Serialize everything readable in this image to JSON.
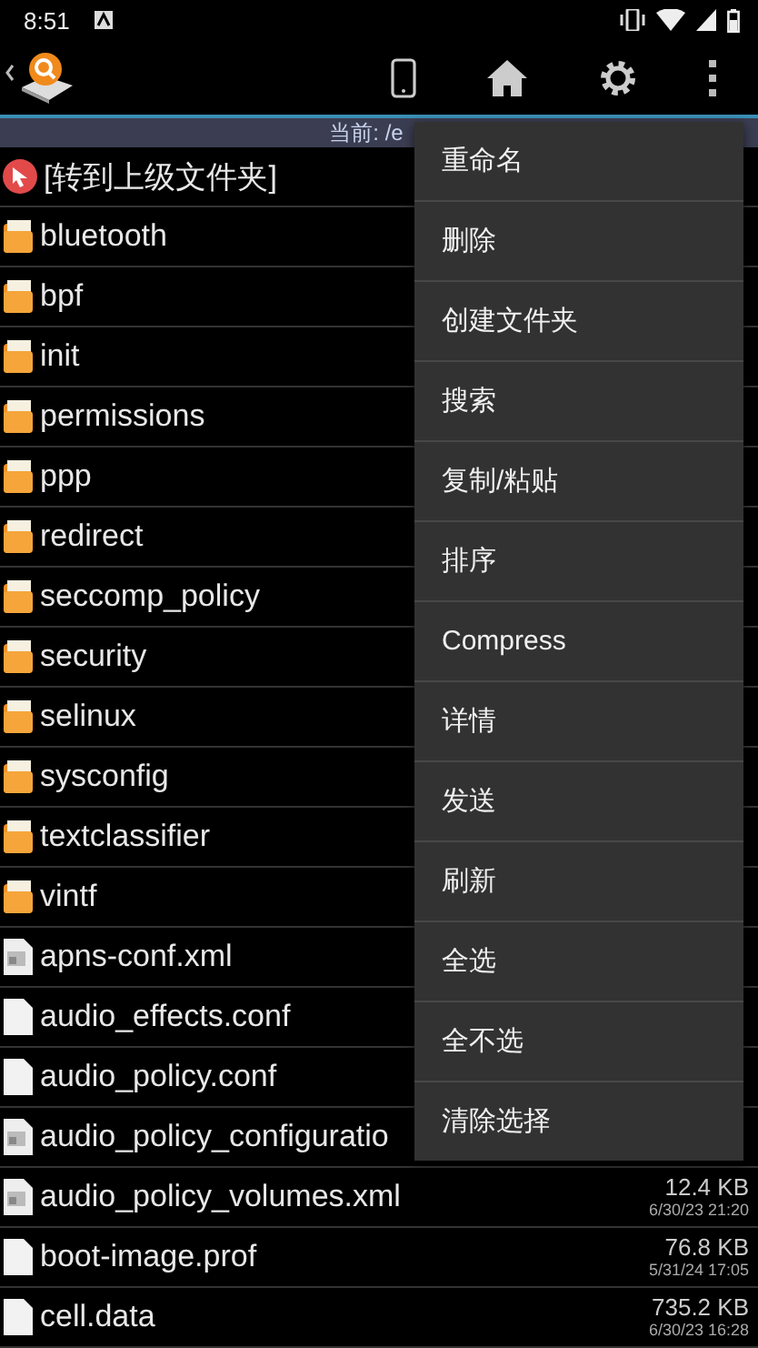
{
  "status_bar": {
    "time": "8:51"
  },
  "path_bar": {
    "text": "当前: /e"
  },
  "files": [
    {
      "kind": "up",
      "name": "[转到上级文件夹]"
    },
    {
      "kind": "folder",
      "name": "bluetooth"
    },
    {
      "kind": "folder",
      "name": "bpf"
    },
    {
      "kind": "folder",
      "name": "init"
    },
    {
      "kind": "folder",
      "name": "permissions"
    },
    {
      "kind": "folder",
      "name": "ppp"
    },
    {
      "kind": "folder",
      "name": "redirect"
    },
    {
      "kind": "folder",
      "name": "seccomp_policy"
    },
    {
      "kind": "folder",
      "name": "security"
    },
    {
      "kind": "folder",
      "name": "selinux"
    },
    {
      "kind": "folder",
      "name": "sysconfig"
    },
    {
      "kind": "folder",
      "name": "textclassifier"
    },
    {
      "kind": "folder",
      "name": "vintf"
    },
    {
      "kind": "xml",
      "name": "apns-conf.xml"
    },
    {
      "kind": "file",
      "name": "audio_effects.conf"
    },
    {
      "kind": "file",
      "name": "audio_policy.conf"
    },
    {
      "kind": "xml",
      "name": "audio_policy_configuratio"
    },
    {
      "kind": "xml",
      "name": "audio_policy_volumes.xml",
      "size": "12.4 KB",
      "date": "6/30/23 21:20"
    },
    {
      "kind": "file",
      "name": "boot-image.prof",
      "size": "76.8 KB",
      "date": "5/31/24 17:05"
    },
    {
      "kind": "file",
      "name": "cell.data",
      "size": "735.2 KB",
      "date": "6/30/23 16:28"
    }
  ],
  "menu": [
    "重命名",
    "删除",
    "创建文件夹",
    "搜索",
    "复制/粘贴",
    "排序",
    "Compress",
    "详情",
    "发送",
    "刷新",
    "全选",
    "全不选",
    "清除选择"
  ]
}
